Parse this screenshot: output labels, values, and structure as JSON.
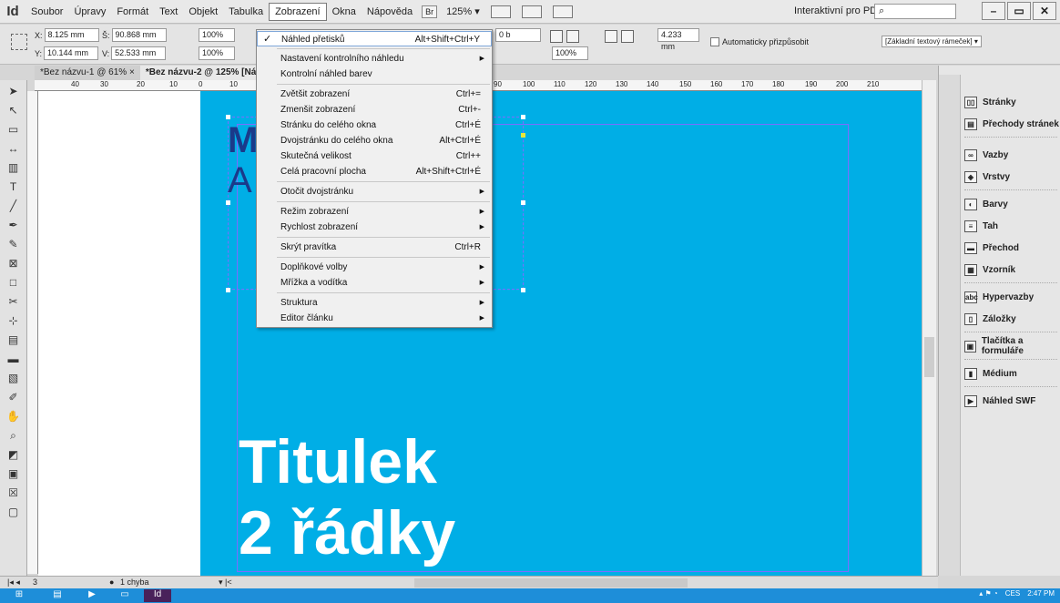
{
  "menubar": {
    "logo": "Id",
    "items": [
      "Soubor",
      "Úpravy",
      "Formát",
      "Text",
      "Objekt",
      "Tabulka",
      "Zobrazení",
      "Okna",
      "Nápověda"
    ],
    "active_index": 6,
    "bridge_label": "Br",
    "zoom": "125% ▾",
    "preset": "Interaktivní pro PDF ▾",
    "search_icon": "search-icon",
    "win": [
      "–",
      "▭",
      "✕"
    ]
  },
  "control": {
    "x_label": "X:",
    "x_value": "8.125 mm",
    "y_label": "Y:",
    "y_value": "10.144 mm",
    "w_label": "Š:",
    "w_value": "90.868 mm",
    "h_label": "V:",
    "h_value": "52.533 mm",
    "scale1": "100%",
    "scale2": "100%",
    "stroke": "0 b",
    "opacity": "100%",
    "offset": "4.233 mm",
    "autofit": "Automaticky přizpůsobit",
    "frame_style": "[Základní textový rámeček] ▾"
  },
  "tabs": [
    "*Bez názvu-1 @ 61%  ×",
    "*Bez názvu-2 @ 125% [Náhled pře"
  ],
  "ruler_ticks": [
    "40",
    "30",
    "20",
    "10",
    "0",
    "10",
    "90",
    "100",
    "110",
    "120",
    "130",
    "140",
    "150",
    "160",
    "170",
    "180",
    "190",
    "200",
    "210"
  ],
  "document": {
    "ghost_line1": "M",
    "ghost_line2": "A",
    "title_line1": "Titulek",
    "title_line2": "2 řádky",
    "page_color": "#00aee6"
  },
  "dropdown": {
    "items": [
      {
        "label": "Náhled přetisků",
        "shortcut": "Alt+Shift+Ctrl+Y",
        "checked": true,
        "highlight": true
      },
      {
        "sep": true
      },
      {
        "label": "Nastavení kontrolního náhledu",
        "submenu": true
      },
      {
        "label": "Kontrolní náhled barev"
      },
      {
        "sep": true
      },
      {
        "label": "Zvětšit zobrazení",
        "shortcut": "Ctrl+="
      },
      {
        "label": "Zmenšit zobrazení",
        "shortcut": "Ctrl+-"
      },
      {
        "label": "Stránku do celého okna",
        "shortcut": "Ctrl+É"
      },
      {
        "label": "Dvojstránku do celého okna",
        "shortcut": "Alt+Ctrl+É"
      },
      {
        "label": "Skutečná velikost",
        "shortcut": "Ctrl++"
      },
      {
        "label": "Celá pracovní plocha",
        "shortcut": "Alt+Shift+Ctrl+É"
      },
      {
        "sep": true
      },
      {
        "label": "Otočit dvojstránku",
        "submenu": true
      },
      {
        "sep": true
      },
      {
        "label": "Režim zobrazení",
        "submenu": true
      },
      {
        "label": "Rychlost zobrazení",
        "submenu": true
      },
      {
        "sep": true
      },
      {
        "label": "Skrýt pravítka",
        "shortcut": "Ctrl+R"
      },
      {
        "sep": true
      },
      {
        "label": "Doplňkové volby",
        "submenu": true
      },
      {
        "label": "Mřížka a vodítka",
        "submenu": true
      },
      {
        "sep": true
      },
      {
        "label": "Struktura",
        "submenu": true
      },
      {
        "label": "Editor článku",
        "submenu": true
      }
    ]
  },
  "panels": [
    {
      "label": "Stránky",
      "icon": "pages-icon",
      "glyph": "▯▯"
    },
    {
      "label": "Přechody stránek",
      "icon": "page-transitions-icon",
      "glyph": "▤"
    },
    {
      "label": "Vazby",
      "icon": "links-icon",
      "glyph": "∞"
    },
    {
      "label": "Vrstvy",
      "icon": "layers-icon",
      "glyph": "◈"
    },
    {
      "label": "Barvy",
      "icon": "color-icon",
      "glyph": "◐"
    },
    {
      "label": "Tah",
      "icon": "stroke-icon",
      "glyph": "≡"
    },
    {
      "label": "Přechod",
      "icon": "gradient-icon",
      "glyph": "▬"
    },
    {
      "label": "Vzorník",
      "icon": "swatches-icon",
      "glyph": "▦"
    },
    {
      "label": "Hypervazby",
      "icon": "hyperlinks-icon",
      "glyph": "abc"
    },
    {
      "label": "Záložky",
      "icon": "bookmarks-icon",
      "glyph": "▯"
    },
    {
      "label": "Tlačítka a formuláře",
      "icon": "buttons-forms-icon",
      "glyph": "▣"
    },
    {
      "label": "Médium",
      "icon": "media-icon",
      "glyph": "▮"
    },
    {
      "label": "Náhled SWF",
      "icon": "swf-preview-icon",
      "glyph": "▶"
    }
  ],
  "status": {
    "page": "3",
    "errors": "1 chyba",
    "arrow": "▾ |<"
  },
  "taskbar": {
    "clock": "2:47 PM",
    "lang": "CES",
    "app": "Id"
  }
}
